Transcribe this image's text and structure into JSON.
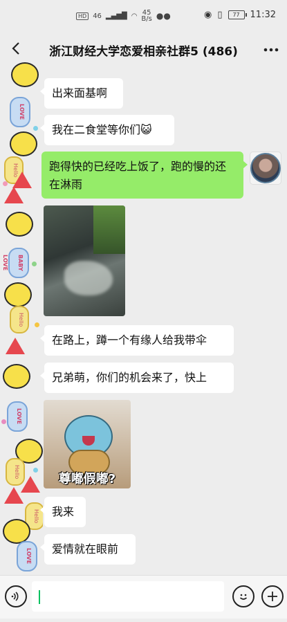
{
  "status_bar": {
    "network": "46",
    "speed_value": "45",
    "speed_unit": "B/s",
    "battery": "77",
    "time": "11:32"
  },
  "header": {
    "title": "浙江财经大学恋爱相亲社群5 (486)"
  },
  "messages": [
    {
      "side": "left",
      "type": "text",
      "text": "出来面基啊"
    },
    {
      "side": "left",
      "type": "text",
      "text": "我在二食堂等你们😺"
    },
    {
      "side": "right",
      "type": "text",
      "text": "跑得快的已经吃上饭了，跑的慢的还在淋雨"
    },
    {
      "side": "left",
      "type": "image",
      "text": ""
    },
    {
      "side": "left",
      "type": "text",
      "text": "在路上，蹲一个有缘人给我带伞"
    },
    {
      "side": "left",
      "type": "text",
      "text": "兄弟萌，你们的机会来了，快上"
    },
    {
      "side": "left",
      "type": "sticker",
      "text": "尊嘟假嘟?"
    },
    {
      "side": "left",
      "type": "text",
      "text": "我来"
    },
    {
      "side": "left",
      "type": "text",
      "text": "爱情就在眼前"
    }
  ],
  "stickers": {
    "love": "LOVE",
    "hello": "Hello",
    "baby_love": "BABY LOVE"
  },
  "input_bar": {
    "value": "",
    "voice_icon": "voice-icon",
    "emoji_icon": "emoji-icon",
    "plus_icon": "plus-icon"
  },
  "colors": {
    "background": "#ededed",
    "self_bubble": "#95ec69",
    "other_bubble": "#ffffff",
    "caret": "#07c160"
  }
}
